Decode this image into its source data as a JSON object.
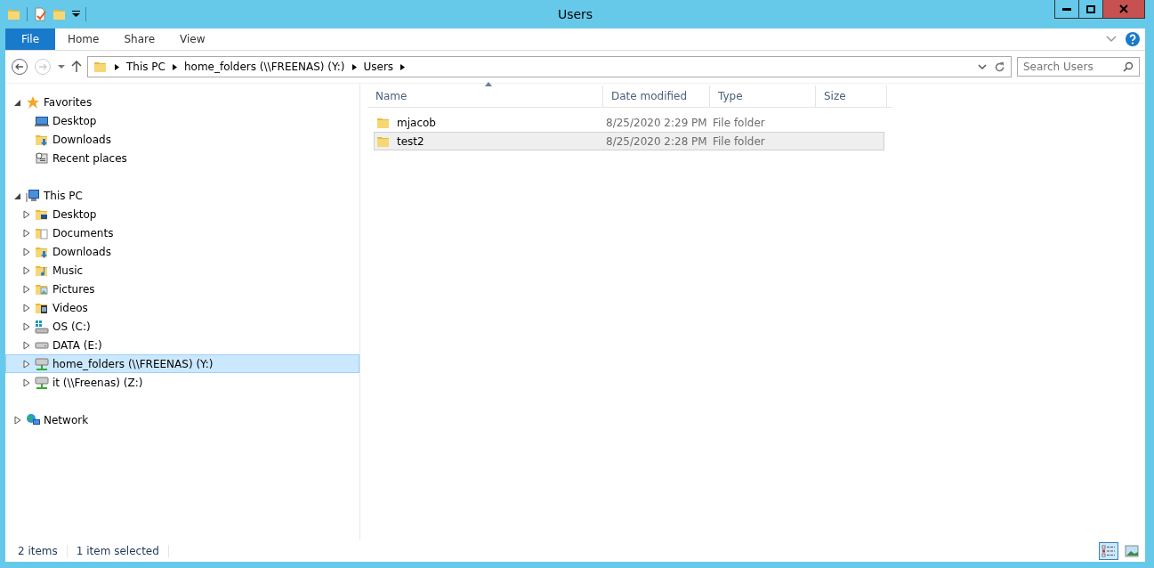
{
  "window": {
    "title": "Users"
  },
  "ribbon": {
    "tabs": [
      {
        "label": "File",
        "kind": "file"
      },
      {
        "label": "Home",
        "kind": "tab"
      },
      {
        "label": "Share",
        "kind": "tab"
      },
      {
        "label": "View",
        "kind": "tab"
      }
    ]
  },
  "address_bar": {
    "path": [
      "This PC",
      "home_folders (\\\\FREENAS) (Y:)",
      "Users"
    ]
  },
  "search": {
    "placeholder": "Search Users"
  },
  "sidebar": {
    "items": [
      {
        "label": "Favorites",
        "kind": "star",
        "expanded": true,
        "selected": false,
        "children": [
          {
            "label": "Desktop",
            "kind": "desktop",
            "selected": false
          },
          {
            "label": "Downloads",
            "kind": "downloads",
            "selected": false
          },
          {
            "label": "Recent places",
            "kind": "recent",
            "selected": false
          }
        ]
      },
      {
        "label": "This PC",
        "kind": "computer",
        "expanded": true,
        "selected": false,
        "children": [
          {
            "label": "Desktop",
            "kind": "folder-desktop",
            "expanded": false,
            "selected": false
          },
          {
            "label": "Documents",
            "kind": "documents",
            "expanded": false,
            "selected": false
          },
          {
            "label": "Downloads",
            "kind": "downloads",
            "expanded": false,
            "selected": false
          },
          {
            "label": "Music",
            "kind": "music",
            "expanded": false,
            "selected": false
          },
          {
            "label": "Pictures",
            "kind": "pictures",
            "expanded": false,
            "selected": false
          },
          {
            "label": "Videos",
            "kind": "videos",
            "expanded": false,
            "selected": false
          },
          {
            "label": "OS (C:)",
            "kind": "os-drive",
            "expanded": false,
            "selected": false
          },
          {
            "label": "DATA (E:)",
            "kind": "drive",
            "expanded": false,
            "selected": false
          },
          {
            "label": "home_folders (\\\\FREENAS) (Y:)",
            "kind": "network-drive",
            "expanded": false,
            "selected": true
          },
          {
            "label": "it (\\\\Freenas) (Z:)",
            "kind": "network-drive",
            "expanded": false,
            "selected": false
          }
        ]
      },
      {
        "label": "Network",
        "kind": "network",
        "expanded": false,
        "selected": false
      }
    ]
  },
  "table": {
    "columns": [
      {
        "label": "Name",
        "sorted": true
      },
      {
        "label": "Date modified",
        "sorted": false
      },
      {
        "label": "Type",
        "sorted": false
      },
      {
        "label": "Size",
        "sorted": false
      }
    ],
    "rows": [
      {
        "name": "mjacob",
        "date": "8/25/2020 2:29 PM",
        "type": "File folder",
        "selected": false
      },
      {
        "name": "test2",
        "date": "8/25/2020 2:28 PM",
        "type": "File folder",
        "selected": true
      }
    ]
  },
  "status_bar": {
    "count": "2 items",
    "selection": "1 item selected",
    "views": [
      {
        "kind": "details",
        "selected": true
      },
      {
        "kind": "tiles",
        "selected": false
      }
    ]
  }
}
